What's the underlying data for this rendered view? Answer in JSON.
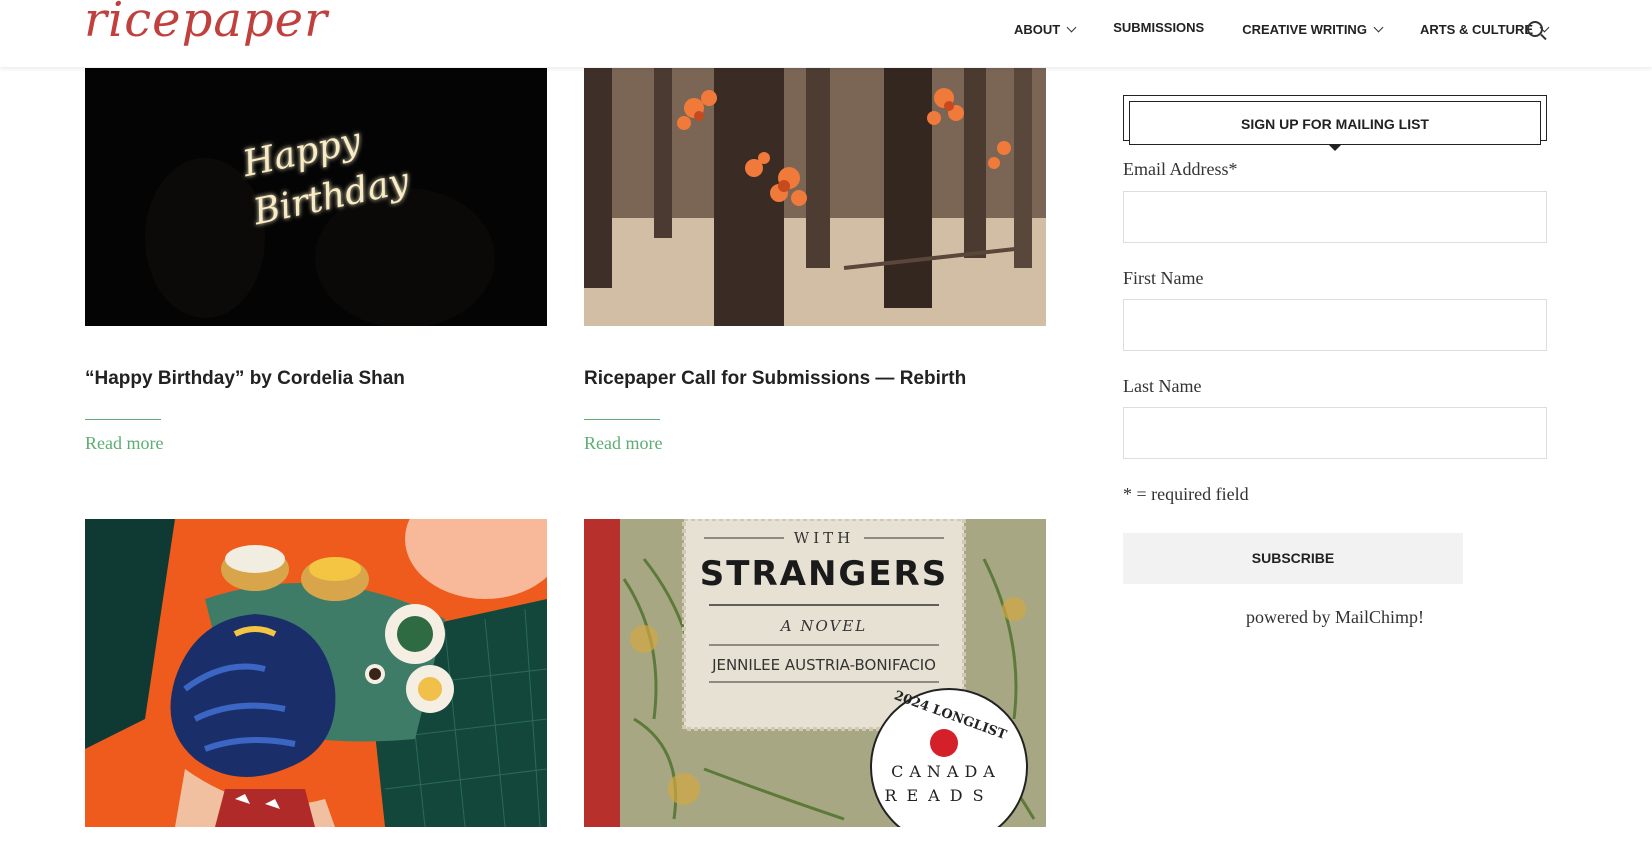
{
  "header": {
    "logo": "ricepaper",
    "nav": [
      {
        "label": "ABOUT",
        "has_dropdown": true
      },
      {
        "label": "SUBMISSIONS",
        "has_dropdown": false
      },
      {
        "label": "CREATIVE WRITING",
        "has_dropdown": true
      },
      {
        "label": "ARTS & CULTURE",
        "has_dropdown": true
      }
    ],
    "search_icon": "search-icon"
  },
  "posts": [
    {
      "title": "“Happy Birthday” by Cordelia Shan",
      "read_more": "Read more",
      "image_text": [
        "Happy",
        "Birthday"
      ]
    },
    {
      "title": "Ricepaper Call for Submissions — Rebirth",
      "read_more": "Read more"
    },
    {
      "title": ""
    },
    {
      "title": "",
      "cover": {
        "top": "WITH",
        "title": "STRANGERS",
        "subtitle": "A NOVEL",
        "author": "JENNILEE AUSTRIA-BONIFACIO",
        "badge_top": "2024 LONGLIST",
        "badge_line1": "CANADA",
        "badge_line2": "READS"
      }
    }
  ],
  "sidebar": {
    "widget_title": "SIGN UP FOR MAILING LIST",
    "fields": [
      {
        "label": "Email Address*",
        "value": ""
      },
      {
        "label": "First Name",
        "value": ""
      },
      {
        "label": "Last Name",
        "value": ""
      }
    ],
    "required_note": "* = required field",
    "subscribe_label": "SUBSCRIBE",
    "powered_by": "powered by MailChimp!"
  },
  "colors": {
    "brand": "#c0403e",
    "accent": "#5cae73"
  }
}
